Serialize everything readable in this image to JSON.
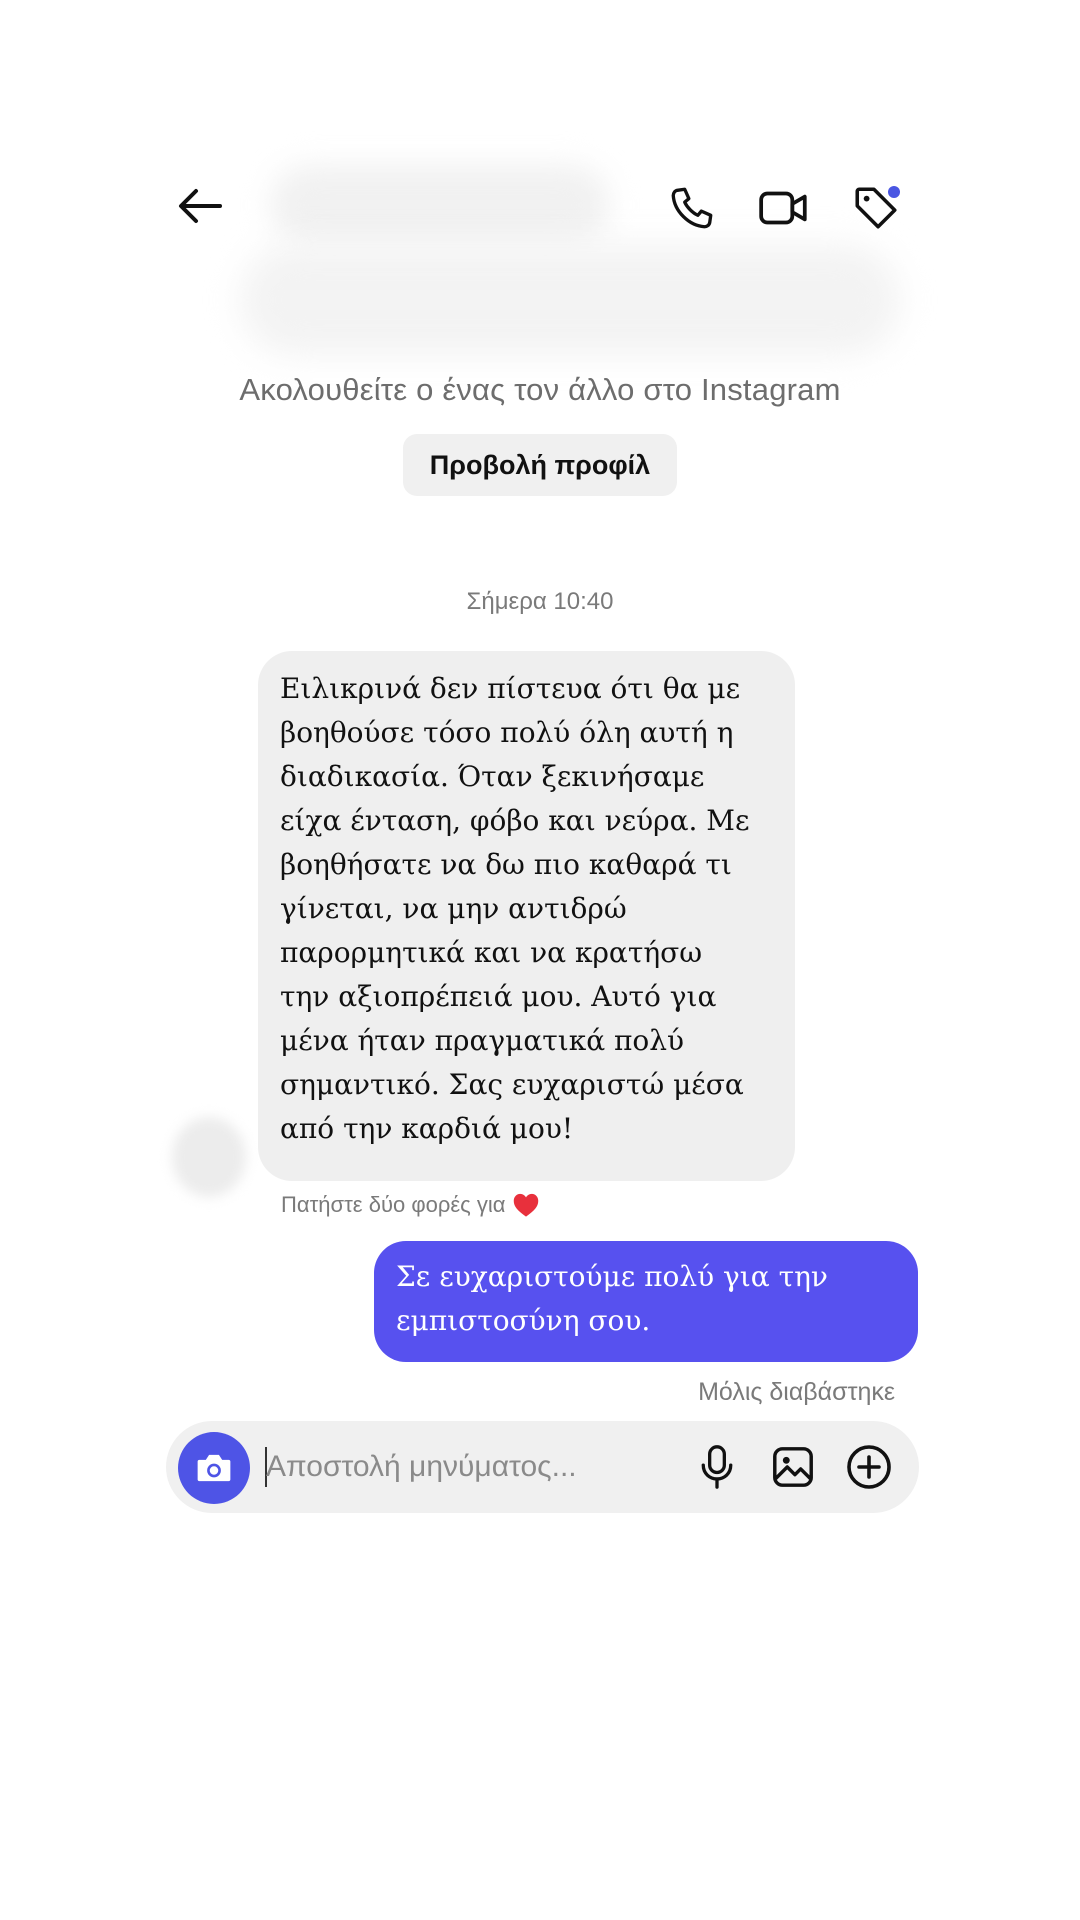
{
  "header": {
    "icons": {
      "back": "back-arrow-icon",
      "call": "phone-icon",
      "video": "video-camera-icon",
      "tag": "tag-icon"
    },
    "notification_dot_color": "#4a56e2"
  },
  "profile_intro": {
    "follow_text": "Ακολουθείτε ο ένας τον άλλο στο Instagram",
    "view_profile_label": "Προβολή προφίλ"
  },
  "conversation": {
    "timestamp": "Σήμερα 10:40",
    "incoming_message": {
      "lines": [
        "Ειλικρινά δεν πίστευα ότι θα με",
        "βοηθούσε τόσο πολύ όλη αυτή η",
        "διαδικασία. Όταν ξεκινήσαμε",
        "είχα ένταση, φόβο και νεύρα. Με",
        "βοηθήσατε να δω πιο καθαρά τι",
        "γίνεται, να μην αντιδρώ",
        "παρορμητικά και να κρατήσω",
        "την αξιοπρέπειά μου. Αυτό για",
        "μένα ήταν πραγματικά πολύ",
        "σημαντικό. Σας ευχαριστώ μέσα",
        "από την καρδιά μου!"
      ],
      "bubble_color": "#efefef"
    },
    "double_tap_hint": "Πατήστε δύο φορές για",
    "outgoing_message": {
      "lines": [
        "Σε ευχαριστούμε πολύ για την",
        "εμπιστοσύνη σου."
      ],
      "bubble_color": "#5751ef"
    },
    "read_status": "Μόλις διαβάστηκε"
  },
  "composer": {
    "placeholder": "Αποστολή μηνύματος...",
    "camera_button_color": "#4e54e6",
    "icons": {
      "camera": "camera-icon",
      "mic": "microphone-icon",
      "gallery": "image-icon",
      "add": "plus-circle-icon"
    }
  }
}
